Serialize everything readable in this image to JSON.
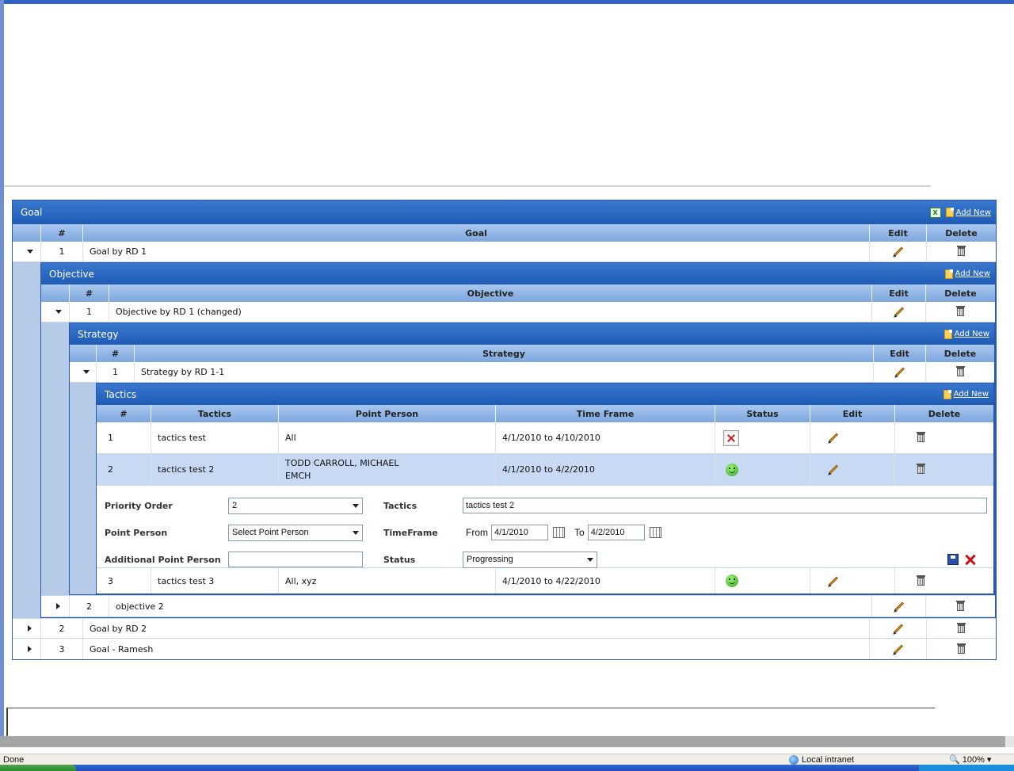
{
  "goal": {
    "title": "Goal",
    "add_new": "Add New",
    "headers": {
      "num": "#",
      "name": "Goal",
      "edit": "Edit",
      "delete": "Delete"
    },
    "rows": [
      {
        "num": "1",
        "name": "Goal by RD 1"
      },
      {
        "num": "2",
        "name": "Goal by RD 2"
      },
      {
        "num": "3",
        "name": "Goal - Ramesh"
      }
    ]
  },
  "objective": {
    "title": "Objective",
    "add_new": "Add New",
    "headers": {
      "num": "#",
      "name": "Objective",
      "edit": "Edit",
      "delete": "Delete"
    },
    "rows": [
      {
        "num": "1",
        "name": "Objective by RD 1 (changed)"
      },
      {
        "num": "2",
        "name": "objective 2"
      }
    ]
  },
  "strategy": {
    "title": "Strategy",
    "add_new": "Add New",
    "headers": {
      "num": "#",
      "name": "Strategy",
      "edit": "Edit",
      "delete": "Delete"
    },
    "rows": [
      {
        "num": "1",
        "name": "Strategy by RD 1-1"
      }
    ]
  },
  "tactics": {
    "title": "Tactics",
    "add_new": "Add New",
    "headers": {
      "num": "#",
      "tactics": "Tactics",
      "point_person": "Point Person",
      "time_frame": "Time Frame",
      "status": "Status",
      "edit": "Edit",
      "delete": "Delete"
    },
    "rows": [
      {
        "num": "1",
        "tactics": "tactics test",
        "point_person": "All",
        "point_person_2": "",
        "time_frame": "4/1/2010 to 4/10/2010",
        "status": "x-icon"
      },
      {
        "num": "2",
        "tactics": "tactics test 2",
        "point_person": "TODD CARROLL, MICHAEL",
        "point_person_2": "EMCH",
        "time_frame": "4/1/2010 to 4/2/2010",
        "status": "smiley-icon"
      },
      {
        "num": "3",
        "tactics": "tactics test 3",
        "point_person": "All, xyz",
        "point_person_2": "",
        "time_frame": "4/1/2010 to 4/22/2010",
        "status": "smiley-icon"
      }
    ],
    "edit_form": {
      "priority_label": "Priority Order",
      "priority_value": "2",
      "tactics_label": "Tactics",
      "tactics_value": "tactics test 2",
      "point_person_label": "Point Person",
      "point_person_value": "Select Point Person",
      "timeframe_label": "TimeFrame",
      "from_label": "From",
      "from_value": "4/1/2010",
      "to_label": "To",
      "to_value": "4/2/2010",
      "additional_label": "Additional Point Person",
      "additional_value": "",
      "status_label": "Status",
      "status_value": "Progressing"
    }
  },
  "statusbar": {
    "done": "Done",
    "zone": "Local intranet",
    "zoom": "100%"
  },
  "colors": {
    "header_blue": "#1f5bb5",
    "column_header": "#7da7de",
    "selected_row": "#c7d9f3",
    "status_good": "#36a81e",
    "status_bad": "#d02020"
  }
}
